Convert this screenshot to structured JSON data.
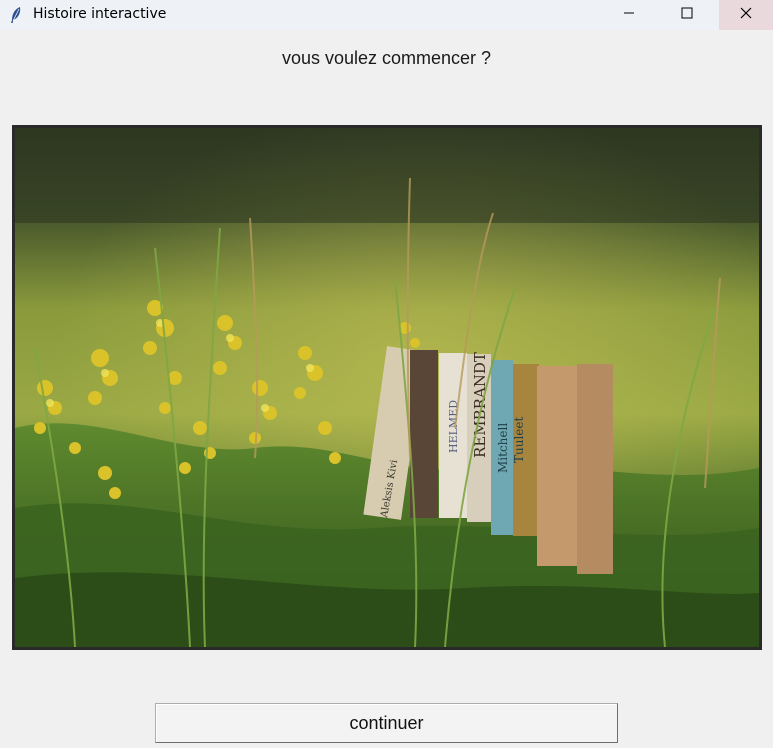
{
  "window": {
    "title": "Histoire interactive",
    "icon": "feather-icon",
    "controls": [
      "minimize-icon",
      "maximize-icon",
      "close-icon"
    ],
    "close_hover_color": "#e9d9dc"
  },
  "main": {
    "prompt": "vous voulez commencer ?",
    "image_spines": [
      "REMBRANDT",
      "Mitchell",
      "Tuuleet",
      "HELMED",
      "Aleksis Kivi"
    ],
    "continue_label": "continuer"
  }
}
